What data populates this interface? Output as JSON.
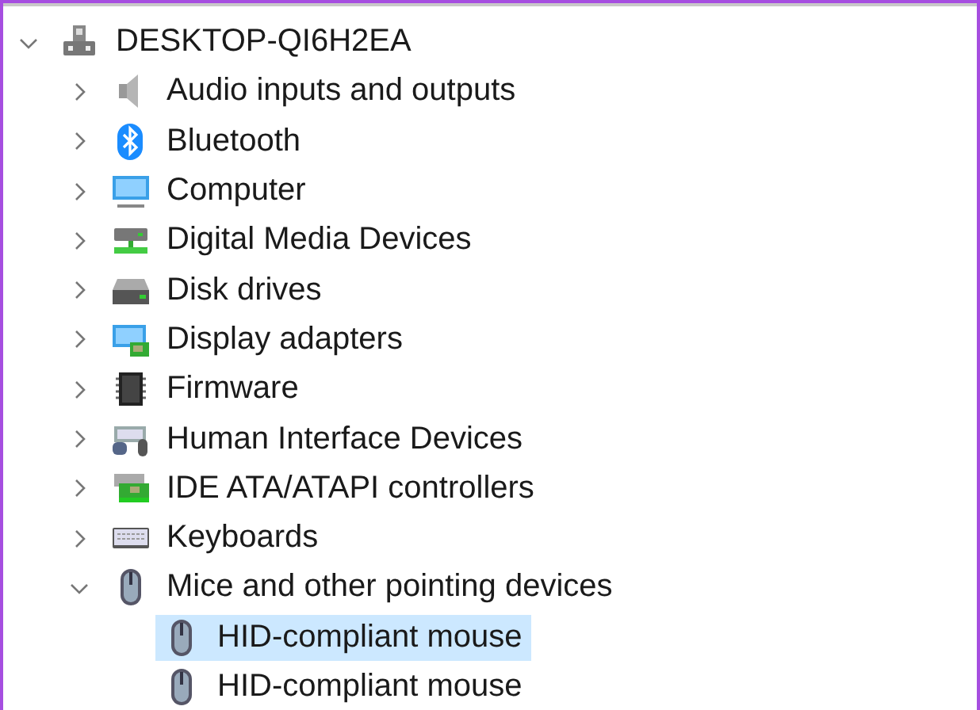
{
  "tree": {
    "label": "DESKTOP-QI6H2EA",
    "kind": "computer-root",
    "expanded": true,
    "selected": false,
    "children": [
      {
        "label": "Audio inputs and outputs",
        "kind": "speaker",
        "expanded": false,
        "selected": false
      },
      {
        "label": "Bluetooth",
        "kind": "bluetooth",
        "expanded": false,
        "selected": false
      },
      {
        "label": "Computer",
        "kind": "monitor",
        "expanded": false,
        "selected": false
      },
      {
        "label": "Digital Media Devices",
        "kind": "media",
        "expanded": false,
        "selected": false
      },
      {
        "label": "Disk drives",
        "kind": "disk",
        "expanded": false,
        "selected": false
      },
      {
        "label": "Display adapters",
        "kind": "display",
        "expanded": false,
        "selected": false
      },
      {
        "label": "Firmware",
        "kind": "chip",
        "expanded": false,
        "selected": false
      },
      {
        "label": "Human Interface Devices",
        "kind": "hid",
        "expanded": false,
        "selected": false
      },
      {
        "label": "IDE ATA/ATAPI controllers",
        "kind": "controller",
        "expanded": false,
        "selected": false
      },
      {
        "label": "Keyboards",
        "kind": "keyboard",
        "expanded": false,
        "selected": false
      },
      {
        "label": "Mice and other pointing devices",
        "kind": "mouse",
        "expanded": true,
        "selected": false,
        "children": [
          {
            "label": "HID-compliant mouse",
            "kind": "mouse",
            "selected": true
          },
          {
            "label": "HID-compliant mouse",
            "kind": "mouse",
            "selected": false
          }
        ]
      }
    ]
  }
}
